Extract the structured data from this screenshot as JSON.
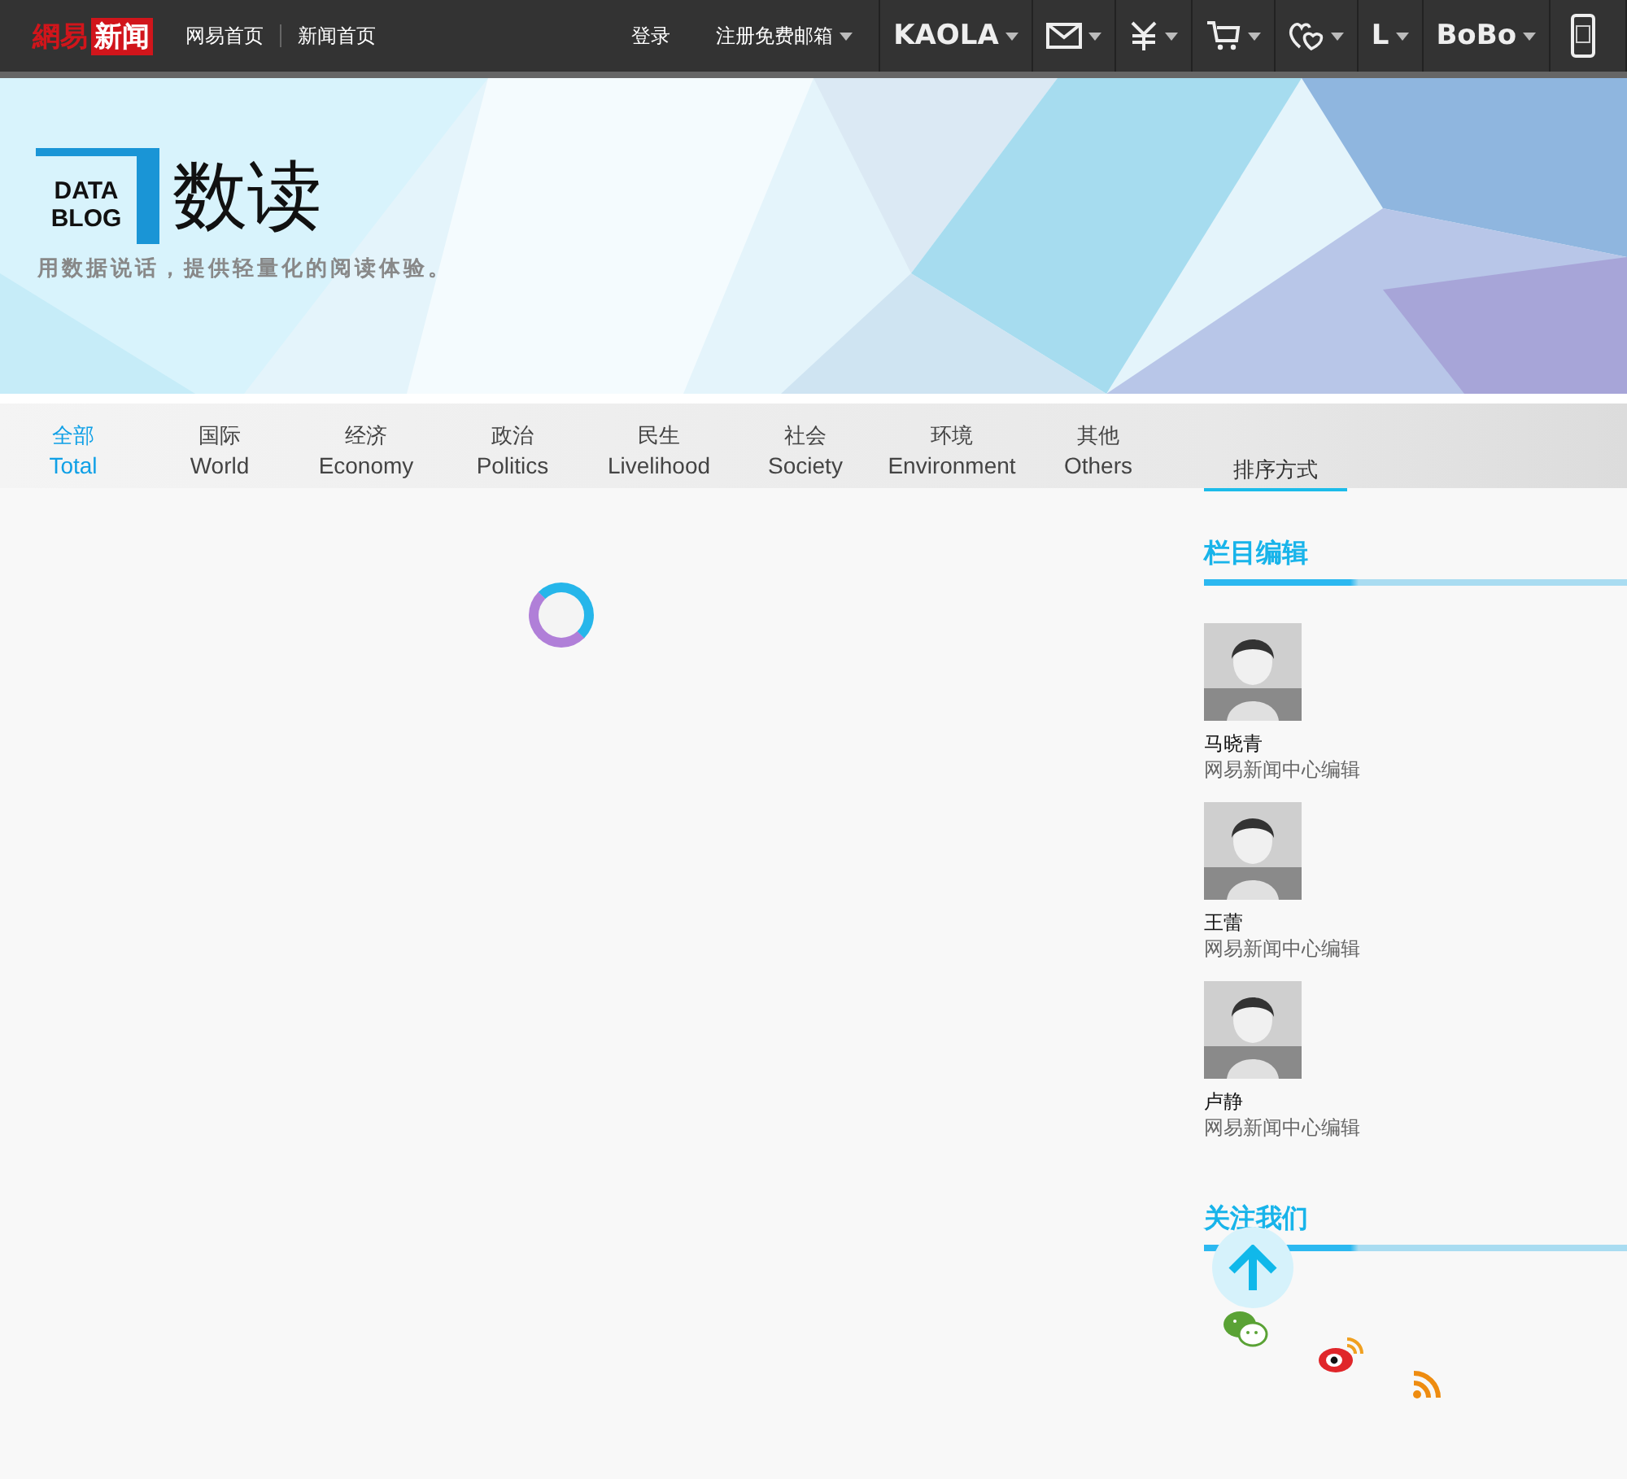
{
  "topbar": {
    "logo_main": "網易",
    "logo_badge": "新闻",
    "links": [
      "网易首页",
      "新闻首页"
    ],
    "login": "登录",
    "register": "注册免费邮箱",
    "menus": [
      {
        "kind": "text",
        "label": "KAOLA"
      },
      {
        "kind": "mail"
      },
      {
        "kind": "yen"
      },
      {
        "kind": "cart"
      },
      {
        "kind": "hearts"
      },
      {
        "kind": "text",
        "label": "L"
      },
      {
        "kind": "text",
        "label": "BoBo"
      },
      {
        "kind": "phone"
      }
    ]
  },
  "banner": {
    "logo_line1": "DATA",
    "logo_line2": "BLOG",
    "title": "数读",
    "tagline": "用数据说话，提供轻量化的阅读体验。"
  },
  "tabs": [
    {
      "zh": "全部",
      "en": "Total",
      "selected": true
    },
    {
      "zh": "国际",
      "en": "World",
      "selected": false
    },
    {
      "zh": "经济",
      "en": "Economy",
      "selected": false
    },
    {
      "zh": "政治",
      "en": "Politics",
      "selected": false
    },
    {
      "zh": "民生",
      "en": "Livelihood",
      "selected": false
    },
    {
      "zh": "社会",
      "en": "Society",
      "selected": false
    },
    {
      "zh": "环境",
      "en": "Environment",
      "selected": false
    },
    {
      "zh": "其他",
      "en": "Others",
      "selected": false
    }
  ],
  "sort": {
    "label": "排序方式"
  },
  "sidebar": {
    "editors_heading": "栏目编辑",
    "editors": [
      {
        "name": "马晓青",
        "role": "网易新闻中心编辑"
      },
      {
        "name": "王蕾",
        "role": "网易新闻中心编辑"
      },
      {
        "name": "卢静",
        "role": "网易新闻中心编辑"
      }
    ],
    "follow_heading": "关注我们",
    "social": [
      {
        "kind": "wechat"
      },
      {
        "kind": "weibo"
      },
      {
        "kind": "rss"
      }
    ]
  }
}
